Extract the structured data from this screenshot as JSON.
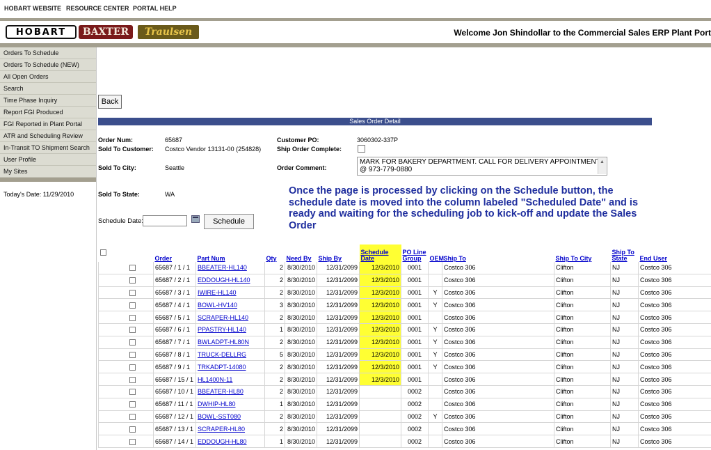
{
  "topnav": {
    "items": [
      "HOBART WEBSITE",
      "RESOURCE CENTER",
      "PORTAL HELP"
    ]
  },
  "brand": {
    "logos": [
      "HOBART",
      "BAXTER",
      "Traulsen"
    ],
    "welcome": "Welcome Jon Shindollar to the Commercial Sales ERP Plant Port"
  },
  "sidebar": {
    "items": [
      "Orders To Schedule",
      "Orders To Schedule (NEW)",
      "All Open Orders",
      "Search",
      "Time Phase Inquiry",
      "Report FGI Produced",
      "FGI Reported in Plant Portal",
      "ATR and Scheduling Review",
      "In-Transit TO Shipment Search",
      "User Profile",
      "My Sites"
    ],
    "today": "Today's Date: 11/29/2010"
  },
  "main": {
    "back_label": "Back",
    "section_title": "Sales Order Detail",
    "order_num_label": "Order Num:",
    "order_num": "65687",
    "sold_to_customer_label": "Sold To Customer:",
    "sold_to_customer": "Costco Vendor 13131-00 (254828)",
    "customer_po_label": "Customer PO:",
    "customer_po": "3060302-337P",
    "ship_complete_label": "Ship Order Complete:",
    "sold_to_city_label": "Sold To City:",
    "sold_to_city": "Seattle",
    "order_comment_label": "Order Comment:",
    "order_comment": "MARK FOR BAKERY DEPARTMENT.  CALL FOR DELIVERY APPOINTMENT @ 973-779-0880",
    "sold_to_state_label": "Sold To State:",
    "sold_to_state": "WA",
    "callout": "Once the page is processed by clicking on the Schedule button, the schedule date is moved into the column labeled \"Scheduled Date\" and is ready and waiting for the scheduling job to kick-off and update the Sales Order",
    "schedule_date_label": "Schedule Date:",
    "schedule_date_value": "",
    "schedule_button": "Schedule"
  },
  "table": {
    "headers": {
      "order": "Order",
      "part_num": "Part Num",
      "qty": "Qty",
      "need_by": "Need By",
      "ship_by": "Ship By",
      "schedule_date": "Schedule Date",
      "po_line_group": "PO Line Group",
      "oem": "OEM",
      "ship_to": "Ship To",
      "ship_to_city": "Ship To City",
      "ship_to_state": "Ship To State",
      "end_user": "End User"
    },
    "rows": [
      {
        "order": "65687 / 1 / 1",
        "part": "BBEATER-HL140",
        "qty": "2",
        "need": "8/30/2010",
        "ship": "12/31/2099",
        "sched": "12/3/2010",
        "group": "0001",
        "oem": "",
        "to": "Costco 306",
        "city": "Clifton",
        "state": "NJ",
        "end": "Costco 306"
      },
      {
        "order": "65687 / 2 / 1",
        "part": "EDDOUGH-HL140",
        "qty": "2",
        "need": "8/30/2010",
        "ship": "12/31/2099",
        "sched": "12/3/2010",
        "group": "0001",
        "oem": "",
        "to": "Costco 306",
        "city": "Clifton",
        "state": "NJ",
        "end": "Costco 306"
      },
      {
        "order": "65687 / 3 / 1",
        "part": "IWIRE-HL140",
        "qty": "2",
        "need": "8/30/2010",
        "ship": "12/31/2099",
        "sched": "12/3/2010",
        "group": "0001",
        "oem": "Y",
        "to": "Costco 306",
        "city": "Clifton",
        "state": "NJ",
        "end": "Costco 306"
      },
      {
        "order": "65687 / 4 / 1",
        "part": "BOWL-HV140",
        "qty": "3",
        "need": "8/30/2010",
        "ship": "12/31/2099",
        "sched": "12/3/2010",
        "group": "0001",
        "oem": "Y",
        "to": "Costco 306",
        "city": "Clifton",
        "state": "NJ",
        "end": "Costco 306"
      },
      {
        "order": "65687 / 5 / 1",
        "part": "SCRAPER-HL140",
        "qty": "2",
        "need": "8/30/2010",
        "ship": "12/31/2099",
        "sched": "12/3/2010",
        "group": "0001",
        "oem": "",
        "to": "Costco 306",
        "city": "Clifton",
        "state": "NJ",
        "end": "Costco 306"
      },
      {
        "order": "65687 / 6 / 1",
        "part": "PPASTRY-HL140",
        "qty": "1",
        "need": "8/30/2010",
        "ship": "12/31/2099",
        "sched": "12/3/2010",
        "group": "0001",
        "oem": "Y",
        "to": "Costco 306",
        "city": "Clifton",
        "state": "NJ",
        "end": "Costco 306"
      },
      {
        "order": "65687 / 7 / 1",
        "part": "BWLADPT-HL80N",
        "qty": "2",
        "need": "8/30/2010",
        "ship": "12/31/2099",
        "sched": "12/3/2010",
        "group": "0001",
        "oem": "Y",
        "to": "Costco 306",
        "city": "Clifton",
        "state": "NJ",
        "end": "Costco 306"
      },
      {
        "order": "65687 / 8 / 1",
        "part": "TRUCK-DELLRG",
        "qty": "5",
        "need": "8/30/2010",
        "ship": "12/31/2099",
        "sched": "12/3/2010",
        "group": "0001",
        "oem": "Y",
        "to": "Costco 306",
        "city": "Clifton",
        "state": "NJ",
        "end": "Costco 306"
      },
      {
        "order": "65687 / 9 / 1",
        "part": "TRKADPT-14080",
        "qty": "2",
        "need": "8/30/2010",
        "ship": "12/31/2099",
        "sched": "12/3/2010",
        "group": "0001",
        "oem": "Y",
        "to": "Costco 306",
        "city": "Clifton",
        "state": "NJ",
        "end": "Costco 306"
      },
      {
        "order": "65687 / 15 / 1",
        "part": "HL1400N-11",
        "qty": "2",
        "need": "8/30/2010",
        "ship": "12/31/2099",
        "sched": "12/3/2010",
        "group": "0001",
        "oem": "",
        "to": "Costco 306",
        "city": "Clifton",
        "state": "NJ",
        "end": "Costco 306"
      },
      {
        "order": "65687 / 10 / 1",
        "part": "BBEATER-HL80",
        "qty": "2",
        "need": "8/30/2010",
        "ship": "12/31/2099",
        "sched": "",
        "group": "0002",
        "oem": "",
        "to": "Costco 306",
        "city": "Clifton",
        "state": "NJ",
        "end": "Costco 306"
      },
      {
        "order": "65687 / 11 / 1",
        "part": "DWHIP-HL80",
        "qty": "1",
        "need": "8/30/2010",
        "ship": "12/31/2099",
        "sched": "",
        "group": "0002",
        "oem": "",
        "to": "Costco 306",
        "city": "Clifton",
        "state": "NJ",
        "end": "Costco 306"
      },
      {
        "order": "65687 / 12 / 1",
        "part": "BOWL-SST080",
        "qty": "2",
        "need": "8/30/2010",
        "ship": "12/31/2099",
        "sched": "",
        "group": "0002",
        "oem": "Y",
        "to": "Costco 306",
        "city": "Clifton",
        "state": "NJ",
        "end": "Costco 306"
      },
      {
        "order": "65687 / 13 / 1",
        "part": "SCRAPER-HL80",
        "qty": "2",
        "need": "8/30/2010",
        "ship": "12/31/2099",
        "sched": "",
        "group": "0002",
        "oem": "",
        "to": "Costco 306",
        "city": "Clifton",
        "state": "NJ",
        "end": "Costco 306"
      },
      {
        "order": "65687 / 14 / 1",
        "part": "EDDOUGH-HL80",
        "qty": "1",
        "need": "8/30/2010",
        "ship": "12/31/2099",
        "sched": "",
        "group": "0002",
        "oem": "",
        "to": "Costco 306",
        "city": "Clifton",
        "state": "NJ",
        "end": "Costco 306"
      }
    ]
  },
  "colors": {
    "nav_bar": "#a39f8f",
    "menu_bg": "#dcdcd2",
    "detail_bar": "#3b4e8c",
    "callout": "#1f2e9e",
    "highlight": "#ffff33",
    "link": "#0000cc"
  },
  "icons": [
    "calendar-icon"
  ]
}
